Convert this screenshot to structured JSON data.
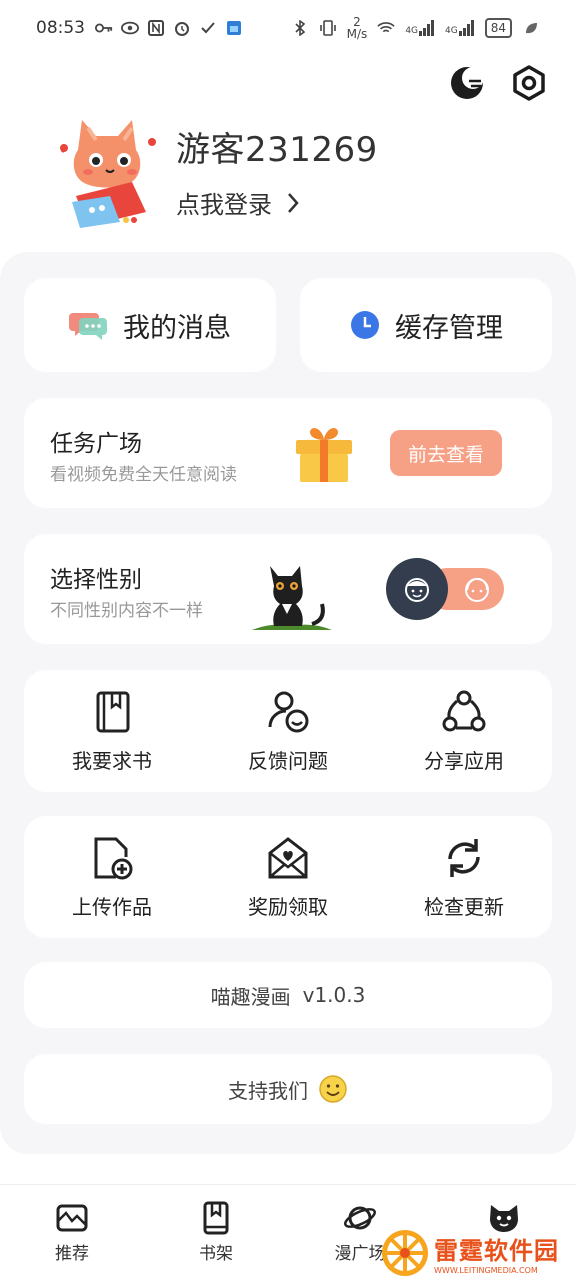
{
  "status_bar": {
    "time": "08:53",
    "net_speed_value": "2",
    "net_speed_unit": "M/s",
    "signal1": "4G",
    "signal2": "4G",
    "battery": "84"
  },
  "header": {
    "theme_icon": "night-mode-icon",
    "settings_icon": "settings-gear-icon"
  },
  "profile": {
    "username": "游客231269",
    "login_label": "点我登录"
  },
  "quick_actions": {
    "messages_label": "我的消息",
    "cache_label": "缓存管理"
  },
  "task": {
    "title": "任务广场",
    "subtitle": "看视频免费全天任意阅读",
    "button_label": "前去查看"
  },
  "gender": {
    "title": "选择性别",
    "subtitle": "不同性别内容不一样"
  },
  "grid_row1": [
    {
      "label": "我要求书",
      "icon": "book-icon"
    },
    {
      "label": "反馈问题",
      "icon": "feedback-icon"
    },
    {
      "label": "分享应用",
      "icon": "share-icon"
    }
  ],
  "grid_row2": [
    {
      "label": "上传作品",
      "icon": "upload-icon"
    },
    {
      "label": "奖励领取",
      "icon": "reward-envelope-icon"
    },
    {
      "label": "检查更新",
      "icon": "refresh-icon"
    }
  ],
  "version": {
    "app_name": "喵趣漫画",
    "version": "v1.0.3"
  },
  "support": {
    "label": "支持我们"
  },
  "bottom_nav": [
    {
      "label": "推荐",
      "icon": "recommend-icon"
    },
    {
      "label": "书架",
      "icon": "bookshelf-icon"
    },
    {
      "label": "漫广场",
      "icon": "planet-icon"
    },
    {
      "label": "",
      "icon": "cat-profile-icon"
    }
  ],
  "watermark": {
    "title": "雷霆软件园",
    "url": "WWW.LEITINGMEDIA.COM"
  },
  "colors": {
    "accent_orange": "#f6a086",
    "dark_knob": "#333d4d",
    "panel_bg": "#f6f6f8"
  }
}
